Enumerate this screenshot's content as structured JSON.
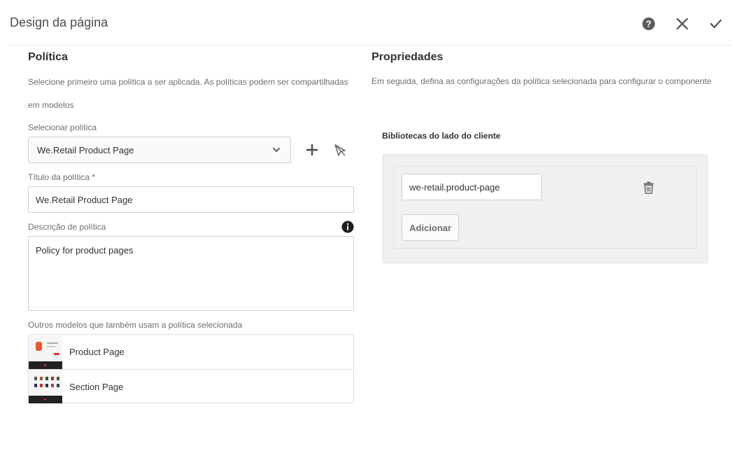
{
  "header": {
    "title": "Design da página",
    "help_icon": "help-icon",
    "close_icon": "close-icon",
    "confirm_icon": "checkmark-icon"
  },
  "policy": {
    "section_title": "Política",
    "description_line1": "Selecione primeiro uma política a ser aplicada. As políticas podem ser compartilhadas",
    "description_line2": "em modelos",
    "select_label": "Selecionar política",
    "select_value": "We.Retail Product Page",
    "add_icon": "plus-icon",
    "select_icon": "select-cursor-icon",
    "title_label": "Título da política *",
    "title_value": "We.Retail Product Page",
    "desc_label": "Descrição de política",
    "info_icon": "info-icon",
    "desc_value": "Policy for product pages",
    "other_templates_label": "Outros modelos que também usam a política selecionada",
    "templates": [
      {
        "name": "Product Page"
      },
      {
        "name": "Section Page"
      }
    ]
  },
  "properties": {
    "section_title": "Propriedades",
    "description": "Em seguida, defina as configurações da política selecionada para configurar o componente",
    "client_libs_label": "Bibliotecas do lado do cliente",
    "client_lib_value": "we-retail.product-page",
    "add_button": "Adicionar",
    "delete_icon": "trash-icon"
  },
  "colors": {
    "text": "#323232",
    "muted": "#6e6e6e",
    "border": "#cfcfcf",
    "panel": "#f0f0f0"
  }
}
